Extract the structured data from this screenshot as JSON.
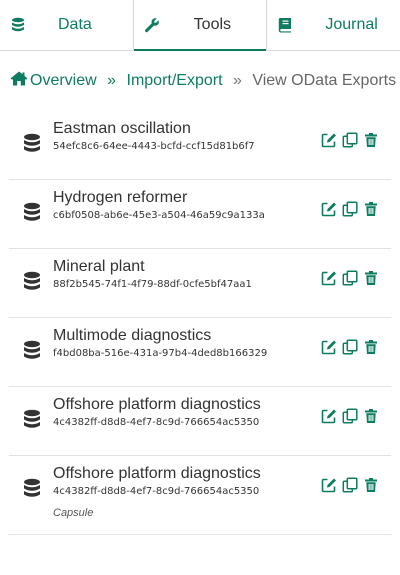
{
  "tabs": [
    {
      "label": "Data",
      "icon": "database-icon",
      "active": false
    },
    {
      "label": "Tools",
      "icon": "wrench-icon",
      "active": true
    },
    {
      "label": "Journal",
      "icon": "book-icon",
      "active": false
    }
  ],
  "breadcrumb": {
    "home_icon": "home-icon",
    "overview": "Overview",
    "sep1": "»",
    "import_export": "Import/Export",
    "sep2": "»",
    "current": "View OData Exports"
  },
  "exports": [
    {
      "name": "Eastman oscillation",
      "id": "54efc8c6-64ee-4443-bcfd-ccf15d81b6f7",
      "tag": ""
    },
    {
      "name": "Hydrogen reformer",
      "id": "c6bf0508-ab6e-45e3-a504-46a59c9a133a",
      "tag": ""
    },
    {
      "name": "Mineral plant",
      "id": "88f2b545-74f1-4f79-88df-0cfe5bf47aa1",
      "tag": ""
    },
    {
      "name": "Multimode diagnostics",
      "id": "f4bd08ba-516e-431a-97b4-4ded8b166329",
      "tag": ""
    },
    {
      "name": "Offshore platform diagnostics",
      "id": "4c4382ff-d8d8-4ef7-8c9d-766654ac5350",
      "tag": ""
    },
    {
      "name": "Offshore platform diagnostics",
      "id": "4c4382ff-d8d8-4ef7-8c9d-766654ac5350",
      "tag": "Capsule"
    }
  ],
  "row_actions": [
    "edit-icon",
    "copy-icon",
    "trash-icon"
  ],
  "colors": {
    "accent": "#0e7c61",
    "text": "#333333",
    "muted": "#666666",
    "divider": "#e3e3e3"
  }
}
